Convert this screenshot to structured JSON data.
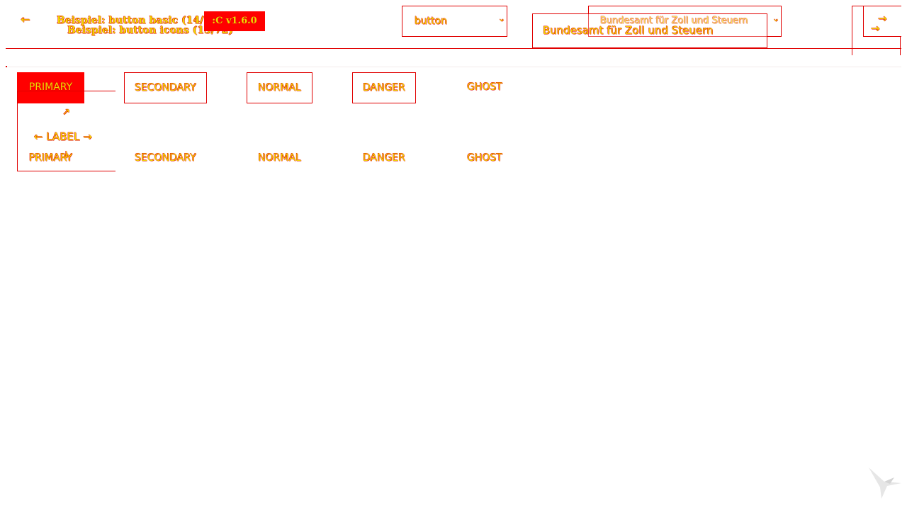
{
  "header": {
    "prev_icon": "arrow-left-icon",
    "title_line1": "Beispiel:  button basic (14/76)",
    "title_line2": "Beispiel:  button icons (15/72)",
    "version_badge": ":C v1.6.0",
    "component_select": {
      "value": "button",
      "icon": "chevron-down-icon"
    },
    "theme_select": {
      "value": "Bundesamt für Zoll und Steuern",
      "icon": "chevron-down-icon"
    },
    "theme_popup_value": "Bundesamt für Zoll und Steuern",
    "next_icon": "arrow-right-icon"
  },
  "buttons_row1": {
    "primary": "PRIMARY",
    "secondary": "SECONDARY",
    "normal": "NORMAL",
    "danger": "DANGER",
    "ghost": "GHOST"
  },
  "buttons_row2": {
    "primary": "PRIMARY",
    "secondary": "SECONDARY",
    "normal": "NORMAL",
    "danger": "DANGER",
    "ghost": "GHOST"
  },
  "icon_button": {
    "label": "LABEL",
    "arrow_left": "←",
    "arrow_right": "→",
    "arrow_up_right": "↗",
    "arrow_down": "↓"
  },
  "glyphs": {
    "prev": "←",
    "next": "→",
    "chevron": "⌄"
  },
  "colors": {
    "outline": "#e00000",
    "text": "#f0d800",
    "primary_fill": "#ff0000"
  },
  "watermark_icon": "bird-logo-icon"
}
